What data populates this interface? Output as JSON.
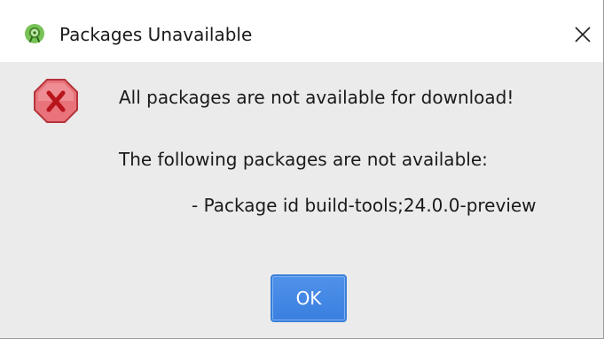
{
  "window": {
    "title": "Packages Unavailable"
  },
  "icons": {
    "app": "android-studio-icon",
    "close": "close-icon",
    "error": "error-icon"
  },
  "message": {
    "main": "All packages are not available for download!",
    "sub": "The following packages are not available:",
    "packages": [
      "- Package id build-tools;24.0.0-preview"
    ]
  },
  "buttons": {
    "ok_label": "OK"
  },
  "colors": {
    "dialog_background": "#ebebeb",
    "title_background": "#ffffff",
    "error_fill": "#e8737a",
    "error_x": "#b8141c",
    "button_blue": "#3a7fe0",
    "app_icon_green": "#78c257"
  }
}
